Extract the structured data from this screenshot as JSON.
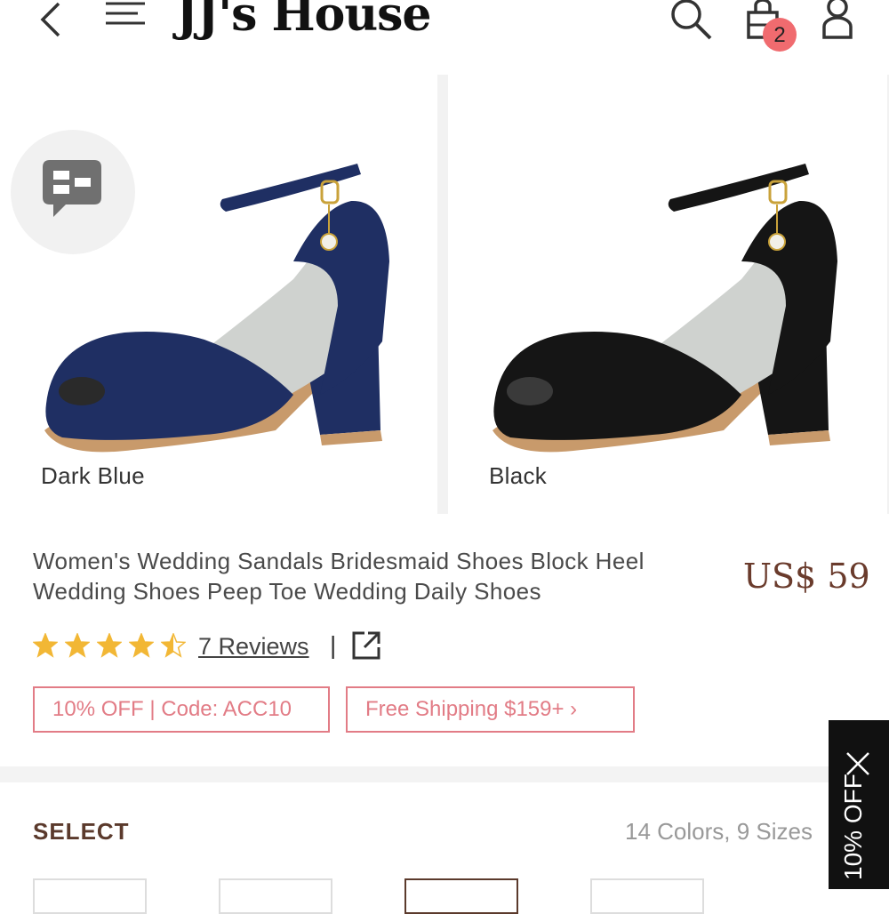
{
  "header": {
    "logo": "JJ's House",
    "cart_count": "2",
    "icons": [
      "back-arrow-icon",
      "menu-icon",
      "search-icon",
      "shopping-bag-icon",
      "user-icon"
    ]
  },
  "gallery": {
    "items": [
      {
        "color_label": "Dark Blue",
        "shoe_color": "#1f2f63"
      },
      {
        "color_label": "Black",
        "shoe_color": "#151515"
      }
    ]
  },
  "product": {
    "title": "Women's Wedding Sandals Bridesmaid Shoes Block Heel Wedding Shoes Peep Toe Wedding Daily Shoes",
    "price": "US$ 59",
    "rating": 4.5,
    "reviews_label": "7 Reviews",
    "separator": "|"
  },
  "promos": {
    "coupon": "10% OFF | Code: ACC10",
    "shipping": "Free Shipping $159+ ›"
  },
  "select": {
    "heading": "SELECT",
    "summary": "14 Colors, 9 Sizes"
  },
  "side_tab": {
    "text": "10% OFF"
  },
  "colors": {
    "accent_pink": "#e27c86",
    "brand_brown": "#5b3a2c",
    "badge": "#f06b6f",
    "star": "#f2b735"
  }
}
